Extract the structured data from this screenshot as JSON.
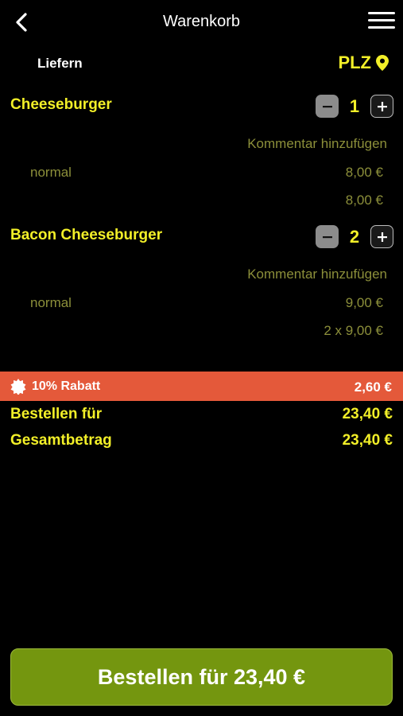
{
  "header": {
    "title": "Warenkorb",
    "back_icon": "chevron-left-icon",
    "menu_icon": "hamburger-menu-icon"
  },
  "delivery": {
    "mode": "Liefern",
    "plz_label": "PLZ",
    "plz_icon": "map-pin-icon"
  },
  "items": [
    {
      "name": "Cheeseburger",
      "quantity": "1",
      "comment_link": "Kommentar hinzufügen",
      "variant": "normal",
      "unit_price": "8,00 €",
      "line_total": "8,00 €"
    },
    {
      "name": "Bacon Cheeseburger",
      "quantity": "2",
      "comment_link": "Kommentar hinzufügen",
      "variant": "normal",
      "unit_price": "9,00 €",
      "line_total": "2 x 9,00 €"
    }
  ],
  "discount": {
    "label": "10% Rabatt",
    "value": "2,60 €",
    "icon": "badge-icon"
  },
  "summary": {
    "order_for_label": "Bestellen für",
    "order_for_value": "23,40 €",
    "total_label": "Gesamtbetrag",
    "total_value": "23,40 €"
  },
  "order_button": {
    "label": "Bestellen für 23,40 €"
  },
  "colors": {
    "accent_yellow": "#f2ef28",
    "muted_olive": "#8c8f3a",
    "discount_bg": "#e4593a",
    "button_green": "#74960f"
  }
}
